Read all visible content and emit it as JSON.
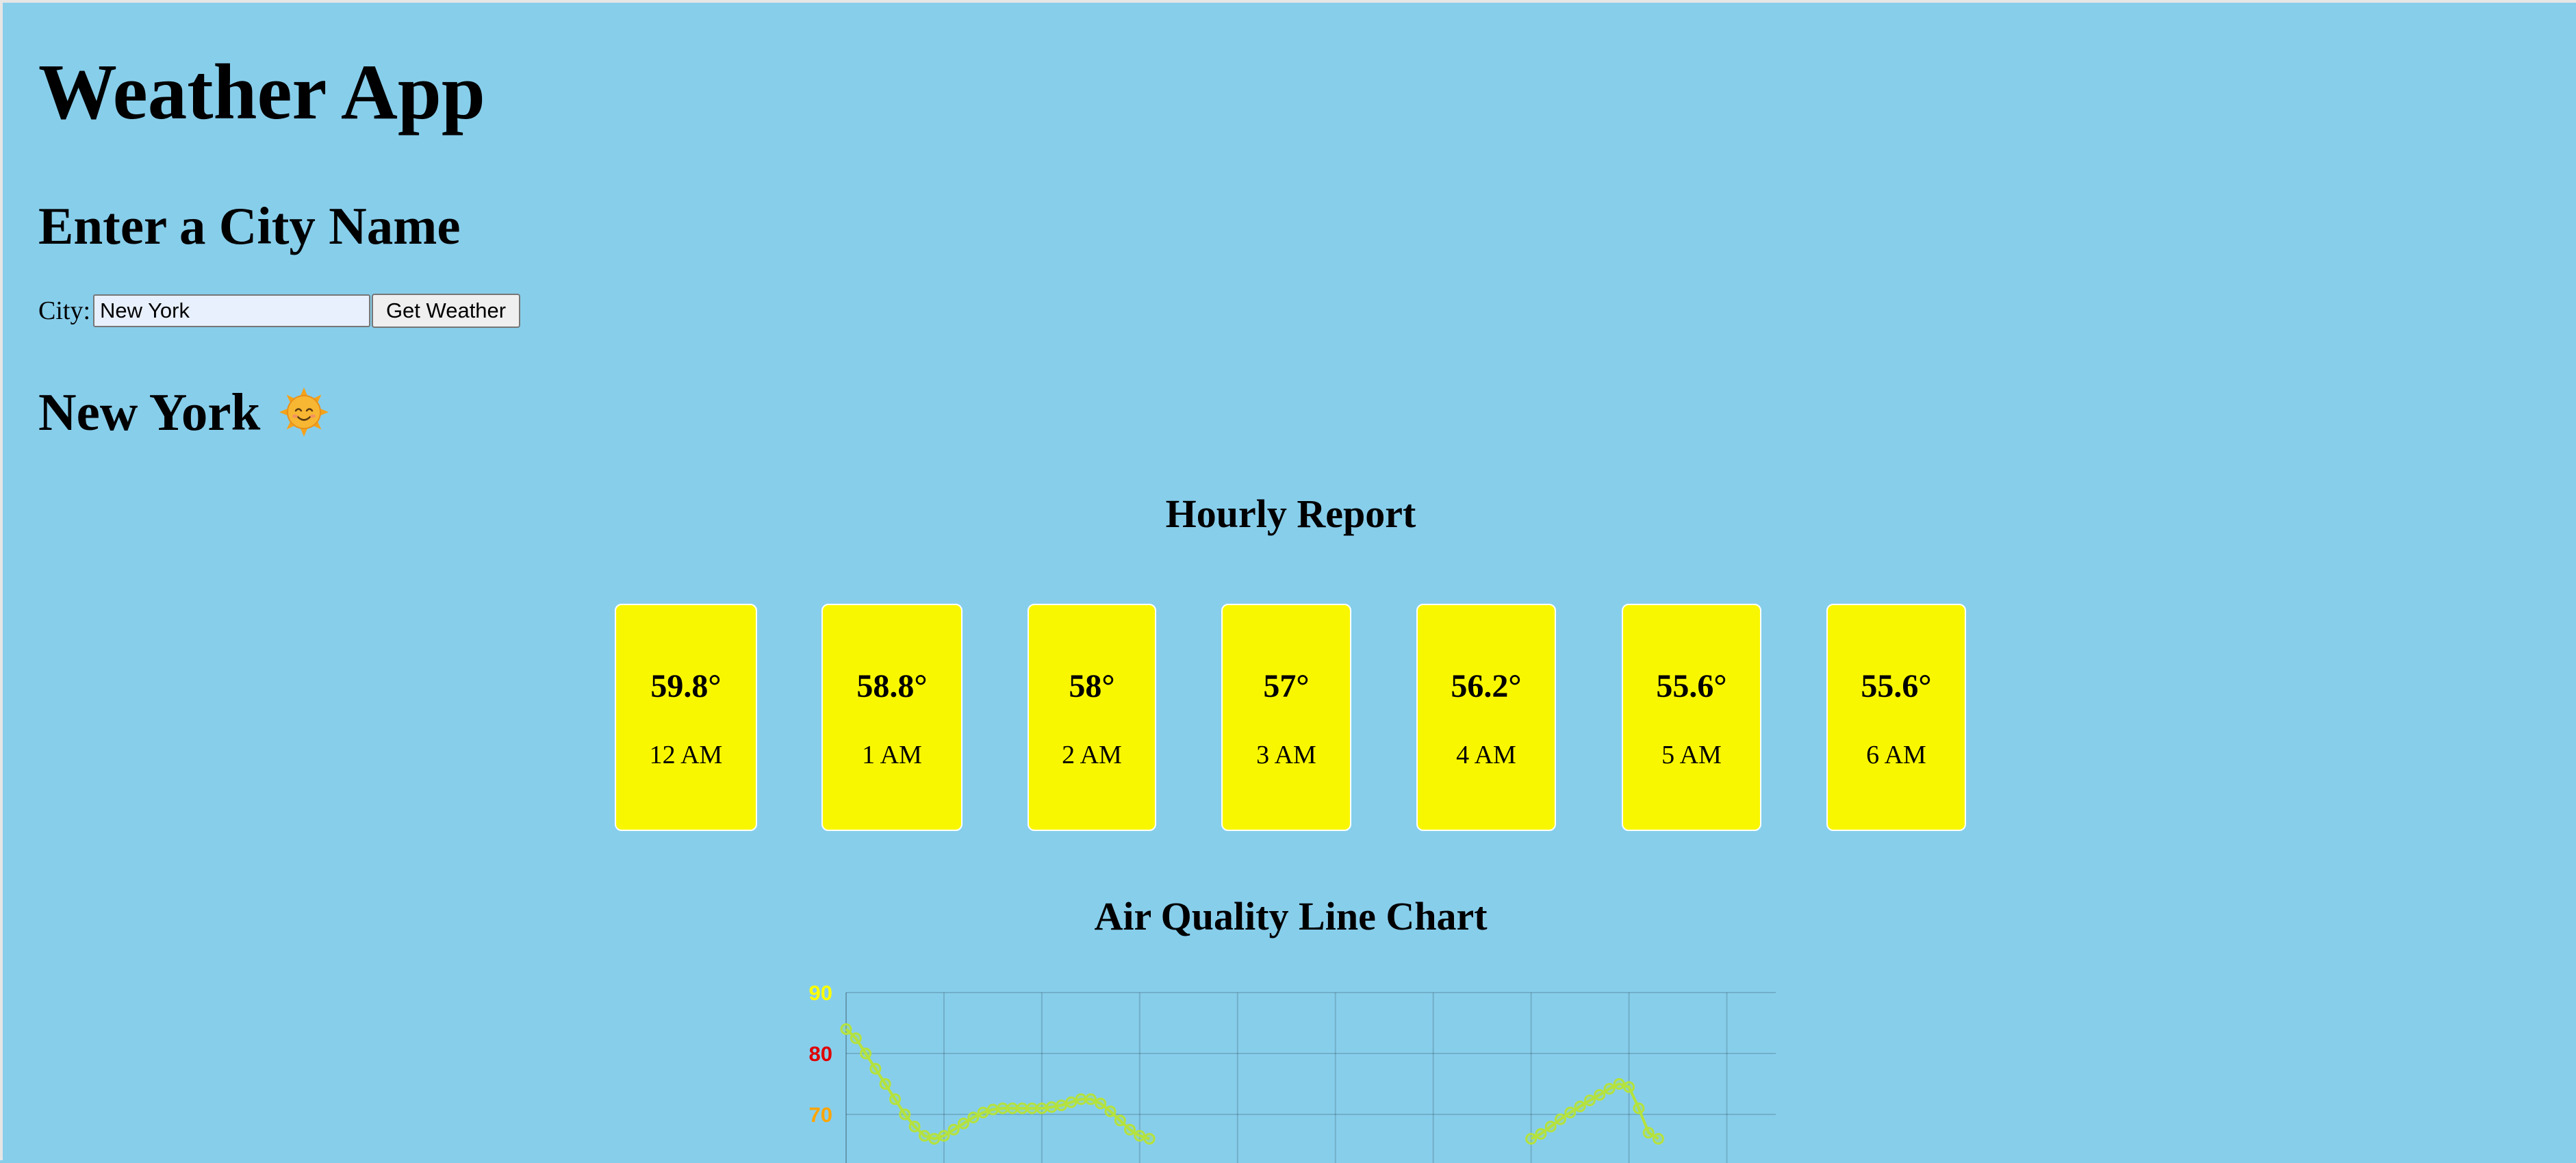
{
  "app": {
    "title": "Weather App"
  },
  "form": {
    "heading": "Enter a City Name",
    "city_label": "City:",
    "city_value": "New York",
    "submit_label": "Get Weather"
  },
  "location": {
    "city": "New York",
    "icon": "smiling-sun-icon"
  },
  "hourly": {
    "title": "Hourly Report",
    "items": [
      {
        "temp": "59.8°",
        "time": "12 AM"
      },
      {
        "temp": "58.8°",
        "time": "1 AM"
      },
      {
        "temp": "58°",
        "time": "2 AM"
      },
      {
        "temp": "57°",
        "time": "3 AM"
      },
      {
        "temp": "56.2°",
        "time": "4 AM"
      },
      {
        "temp": "55.6°",
        "time": "5 AM"
      },
      {
        "temp": "55.6°",
        "time": "6 AM"
      }
    ]
  },
  "colors": {
    "background": "#87CEEB",
    "card": "#F9F700",
    "line": "#B5E23C"
  },
  "chart_data": {
    "type": "line",
    "title": "Air Quality Line Chart",
    "xlabel": "",
    "ylabel": "",
    "grid": true,
    "y_ticks": [
      {
        "label": "90",
        "value": 90,
        "color": "#FFFF00"
      },
      {
        "label": "80",
        "value": 80,
        "color": "#E00000"
      },
      {
        "label": "70",
        "value": 70,
        "color": "#FFA500"
      }
    ],
    "ylim_visible": [
      66,
      90
    ],
    "x_index_range": [
      0,
      95
    ],
    "series": [
      {
        "color": "#B5E23C",
        "points": [
          [
            0,
            84
          ],
          [
            1,
            82.5
          ],
          [
            2,
            80
          ],
          [
            3,
            77.5
          ],
          [
            4,
            75
          ],
          [
            5,
            72.5
          ],
          [
            6,
            70
          ],
          [
            7,
            68
          ],
          [
            8,
            66.5
          ],
          [
            9,
            66
          ],
          [
            10,
            66.5
          ],
          [
            11,
            67.5
          ],
          [
            12,
            68.5
          ],
          [
            13,
            69.5
          ],
          [
            14,
            70.3
          ],
          [
            15,
            70.8
          ],
          [
            16,
            71
          ],
          [
            17,
            71
          ],
          [
            18,
            71
          ],
          [
            19,
            71
          ],
          [
            20,
            71
          ],
          [
            21,
            71.2
          ],
          [
            22,
            71.5
          ],
          [
            23,
            72
          ],
          [
            24,
            72.5
          ],
          [
            25,
            72.5
          ],
          [
            26,
            71.8
          ],
          [
            27,
            70.5
          ],
          [
            28,
            69
          ],
          [
            29,
            67.5
          ],
          [
            30,
            66.5
          ],
          [
            31,
            66
          ],
          [
            70,
            66
          ],
          [
            71,
            66.8
          ],
          [
            72,
            68
          ],
          [
            73,
            69.2
          ],
          [
            74,
            70.3
          ],
          [
            75,
            71.3
          ],
          [
            76,
            72.3
          ],
          [
            77,
            73.2
          ],
          [
            78,
            74.2
          ],
          [
            79,
            75
          ],
          [
            80,
            74.5
          ],
          [
            81,
            71
          ],
          [
            82,
            67
          ],
          [
            83,
            66
          ]
        ]
      }
    ]
  }
}
